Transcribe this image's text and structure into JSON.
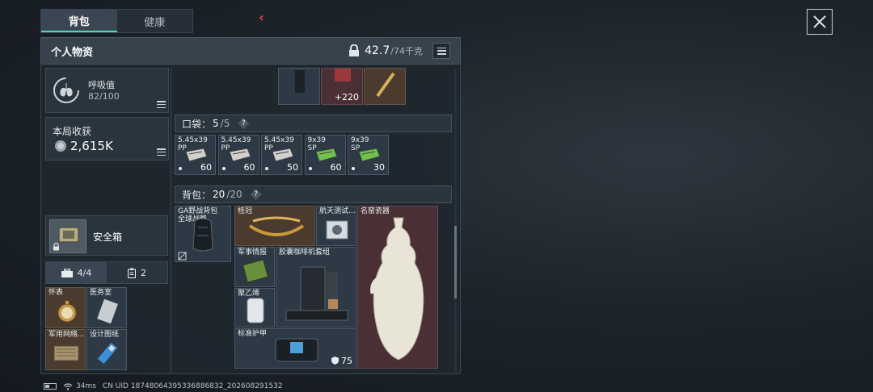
{
  "tabs": [
    {
      "label": "背包"
    },
    {
      "label": "健康"
    }
  ],
  "panel": {
    "title": "个人物资",
    "weight_current": "42.7",
    "weight_max": "/74千克"
  },
  "breath": {
    "label": "呼吸值",
    "value": "82/100"
  },
  "loot": {
    "label": "本局收获",
    "value": "2,615K"
  },
  "safe_box": {
    "label": "安全箱"
  },
  "small_tabs": [
    {
      "label": "4/4"
    },
    {
      "label": "2"
    }
  ],
  "safe_items": [
    {
      "name": "怀表"
    },
    {
      "name": "医务室"
    },
    {
      "name": "军用网络..."
    },
    {
      "name": "设计图纸"
    }
  ],
  "top_row": {
    "qty": "220"
  },
  "pocket": {
    "label": "口袋：",
    "count": "5",
    "total": "/5",
    "help": "?"
  },
  "ammo": [
    {
      "name": "5.45x39\nPP",
      "qty": "60",
      "color": "#d2d0c8"
    },
    {
      "name": "5.45x39\nPP",
      "qty": "60",
      "color": "#d2d0c8"
    },
    {
      "name": "5.45x39\nPP",
      "qty": "50",
      "color": "#d2d0c8"
    },
    {
      "name": "9x39\nSP",
      "qty": "60",
      "color": "#6fc24a"
    },
    {
      "name": "9x39\nSP",
      "qty": "30",
      "color": "#6fc24a"
    }
  ],
  "backpack": {
    "label": "背包：",
    "count": "20",
    "total": "/20",
    "help": "?",
    "bag_name": "GA野战背包\n全球战略"
  },
  "bag_items": [
    {
      "name": "桂冠"
    },
    {
      "name": "航天测试..."
    },
    {
      "name": "名窑瓷器"
    },
    {
      "name": "军事情报"
    },
    {
      "name": "胶囊咖啡机套组"
    },
    {
      "name": "聚乙烯"
    },
    {
      "name": "标准护甲",
      "durability": "75"
    }
  ],
  "status": {
    "ping": "34ms",
    "uid": "CN UID 18748064395336886832_202608291532"
  },
  "colors": {
    "accent": "#4fd6b8",
    "back_arrow": "#e6454a",
    "red_slot": "#4a2f34"
  }
}
